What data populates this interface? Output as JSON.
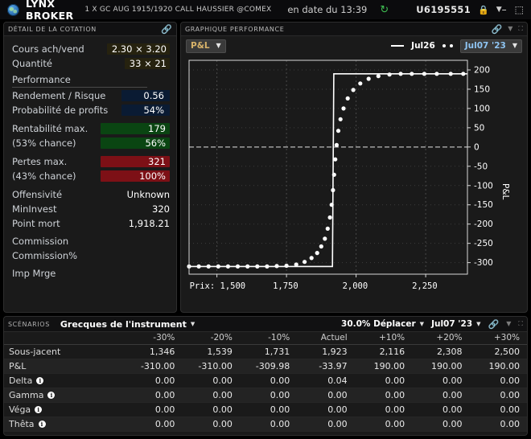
{
  "titlebar": {
    "brand": "LYNX BROKER",
    "contract": "1 X GC AUG 1915/1920 CALL HAUSSIER @COMEX",
    "as_of": "en date du 13:39",
    "refresh_icon": "refresh-icon",
    "account": "U6195551",
    "lock_icon": "lock-icon",
    "caret_icon": "chevron-down-icon",
    "minimize": "–",
    "restore": "⬚",
    "close": "✕",
    "accent_green": "#3fbf52"
  },
  "quote": {
    "title": "Détail de la cotation",
    "link_icon": "link-icon",
    "rows": [
      {
        "label": "Cours ach/vend",
        "value": "2.30 × 3.20",
        "style": "olive"
      },
      {
        "label": "Quantité",
        "value": "33 × 21",
        "style": "olive"
      },
      {
        "label": "Rendement / Risque",
        "value": "0.56",
        "style": "navy"
      },
      {
        "label": "Probabilité de profits",
        "value": "54%",
        "style": "navy"
      },
      {
        "label": "Rentabilité max.",
        "value": "179",
        "style": "green"
      },
      {
        "label": "(53% chance)",
        "value": "56%",
        "style": "green"
      },
      {
        "label": "Pertes max.",
        "value": "321",
        "style": "red"
      },
      {
        "label": "(43% chance)",
        "value": "100%",
        "style": "red"
      },
      {
        "label": "Offensivité",
        "value": "Unknown",
        "style": "plain"
      },
      {
        "label": "MinInvest",
        "value": "320",
        "style": "plain"
      },
      {
        "label": "Point mort",
        "value": "1,918.21",
        "style": "plain"
      },
      {
        "label": "Commission",
        "value": "",
        "style": "plain"
      },
      {
        "label": "Commission%",
        "value": "",
        "style": "plain"
      },
      {
        "label": "Imp Mrge",
        "value": "",
        "style": "plain"
      }
    ],
    "section_title": "Performance"
  },
  "chart": {
    "title": "Graphique performance",
    "link_icon": "link-icon",
    "caret_icon": "chevron-down-icon",
    "expand_icon": "expand-icon",
    "metric_select": "P&L",
    "date_select": "Jul07 '23",
    "legend_line_label": "Jul26",
    "legend_dots_label": ""
  },
  "chart_data": {
    "type": "line",
    "title": "",
    "xlabel": "Prix",
    "ylabel": "P&L",
    "xlim": [
      1400,
      2400
    ],
    "ylim": [
      -330,
      225
    ],
    "x_ticks": [
      1500,
      1750,
      2000,
      2250
    ],
    "x_tick_labels": [
      "1,500",
      "1,750",
      "2,000",
      "2,250"
    ],
    "x_axis_prefix": "Prix:",
    "y_ticks": [
      200,
      150,
      100,
      50,
      0,
      -50,
      -100,
      -150,
      -200,
      -250,
      -300
    ],
    "y_tick_labels": [
      "200",
      "150",
      "100",
      "50",
      "0",
      "-50",
      "-100",
      "-150",
      "-200",
      "-250",
      "-300"
    ],
    "grid": true,
    "zero_line": true,
    "legend_position": "top-right",
    "series": [
      {
        "name": "Jul26",
        "style": "solid",
        "color": "#ffffff",
        "x": [
          1400,
          1915,
          1915,
          1920,
          1920,
          2400
        ],
        "values": [
          -310,
          -310,
          -310,
          190,
          190,
          190
        ]
      },
      {
        "name": "Jul07 '23",
        "style": "dotted",
        "color": "#ffffff",
        "x": [
          1400,
          1435,
          1470,
          1505,
          1540,
          1575,
          1610,
          1645,
          1680,
          1715,
          1750,
          1785,
          1815,
          1840,
          1860,
          1875,
          1888,
          1898,
          1906,
          1912,
          1917,
          1921,
          1925,
          1930,
          1936,
          1944,
          1955,
          1970,
          1990,
          2015,
          2045,
          2080,
          2120,
          2160,
          2200,
          2245,
          2290,
          2340,
          2385
        ],
        "values": [
          -310,
          -310,
          -310,
          -310,
          -310,
          -310,
          -310,
          -310,
          -310,
          -309,
          -308,
          -305,
          -298,
          -288,
          -275,
          -258,
          -238,
          -212,
          -183,
          -150,
          -112,
          -72,
          -32,
          5,
          42,
          72,
          100,
          126,
          148,
          165,
          177,
          184,
          188,
          190,
          190,
          190,
          190,
          190,
          190
        ]
      }
    ]
  },
  "scenarios": {
    "title": "Scénarios",
    "greeks_label": "Grecques de l'instrument",
    "move_label": "30.0% Déplacer",
    "date_label": "Jul07 '23",
    "link_icon": "link-icon",
    "caret_icon": "chevron-down-icon",
    "expand_icon": "expand-icon",
    "columns": [
      "",
      "-30%",
      "-20%",
      "-10%",
      "Actuel",
      "+10%",
      "+20%",
      "+30%"
    ],
    "rows": [
      {
        "label": "Sous-jacent",
        "info": false,
        "values": [
          "1,346",
          "1,539",
          "1,731",
          "1,923",
          "2,116",
          "2,308",
          "2,500"
        ]
      },
      {
        "label": "P&L",
        "info": false,
        "values": [
          "-310.00",
          "-310.00",
          "-309.98",
          "-33.97",
          "190.00",
          "190.00",
          "190.00"
        ]
      },
      {
        "label": "Delta",
        "info": true,
        "values": [
          "0.00",
          "0.00",
          "0.00",
          "0.04",
          "0.00",
          "0.00",
          "0.00"
        ]
      },
      {
        "label": "Gamma",
        "info": true,
        "values": [
          "0.00",
          "0.00",
          "0.00",
          "0.00",
          "0.00",
          "0.00",
          "0.00"
        ]
      },
      {
        "label": "Véga",
        "info": true,
        "values": [
          "0.00",
          "0.00",
          "0.00",
          "0.00",
          "0.00",
          "0.00",
          "0.00"
        ]
      },
      {
        "label": "Thêta",
        "info": true,
        "values": [
          "0.00",
          "0.00",
          "0.00",
          "0.00",
          "0.00",
          "0.00",
          "0.00"
        ]
      }
    ]
  }
}
